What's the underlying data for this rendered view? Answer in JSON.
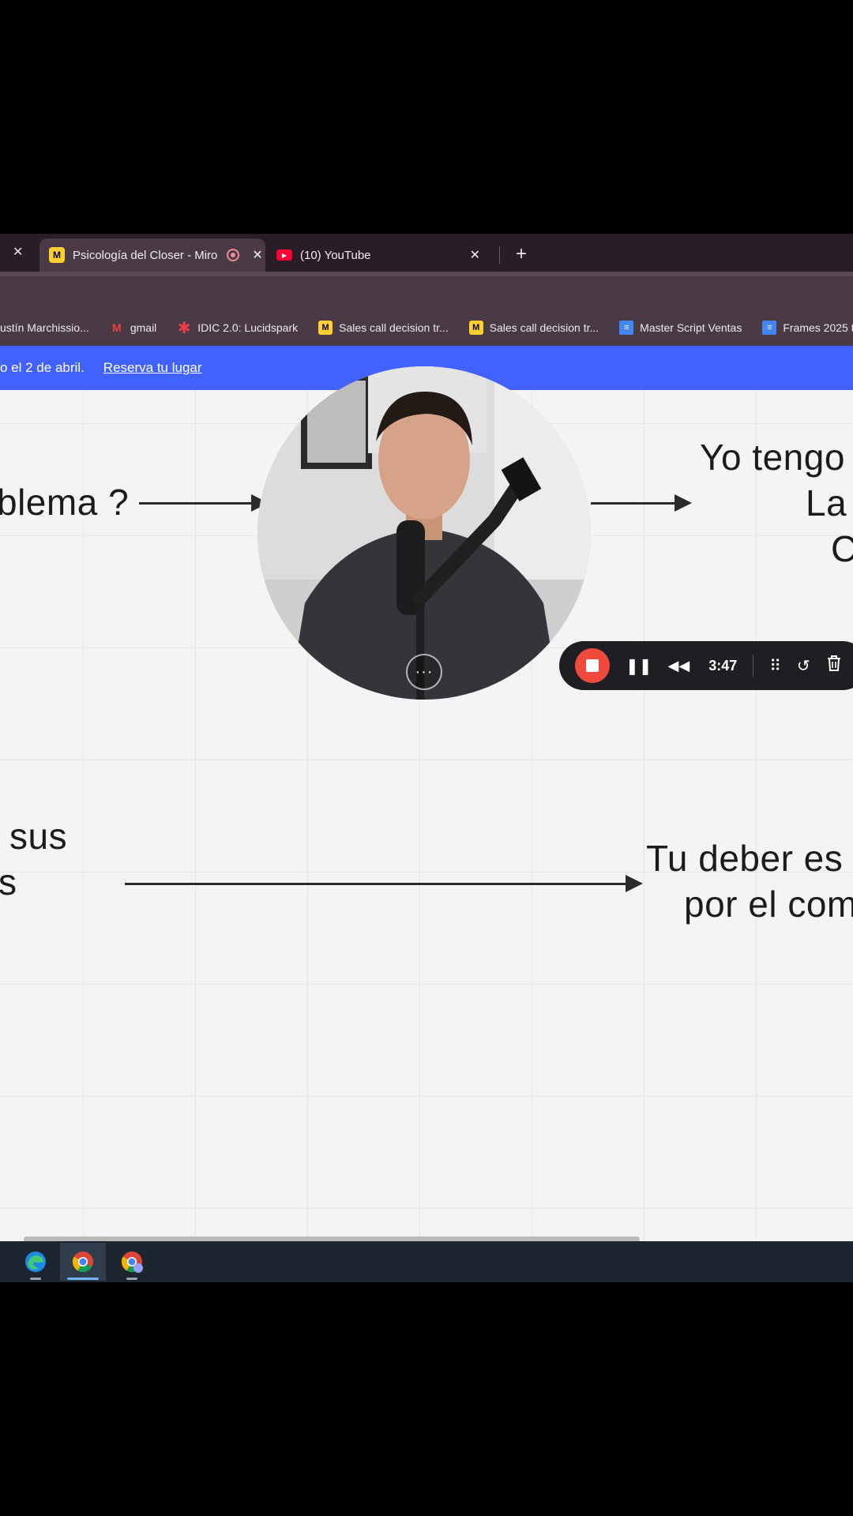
{
  "browser": {
    "tabs": [
      {
        "title": "Psicología del Closer - Miro",
        "active": true,
        "recording": true,
        "favicon": "miro-icon"
      },
      {
        "title": "(10) YouTube",
        "active": false,
        "favicon": "youtube-icon"
      }
    ],
    "close_glyph": "✕",
    "new_tab_glyph": "+",
    "bookmarks": [
      {
        "label": "ustín Marchissio...",
        "icon": "none"
      },
      {
        "label": "gmail",
        "icon": "gmail-icon"
      },
      {
        "label": "IDIC 2.0: Lucidspark",
        "icon": "lucidspark-icon"
      },
      {
        "label": "Sales call decision tr...",
        "icon": "miro-icon"
      },
      {
        "label": "Sales call decision tr...",
        "icon": "miro-icon"
      },
      {
        "label": "Master Script Ventas",
        "icon": "docs-icon"
      },
      {
        "label": "Frames 2025 t",
        "icon": "docs-icon"
      }
    ]
  },
  "banner": {
    "text": "o el 2 de abril.",
    "link": "Reserva tu lugar",
    "color": "#4262ff"
  },
  "board": {
    "text_problem": "blema ?",
    "text_right_1": "Yo tengo",
    "text_right_2": "La",
    "text_right_3": "C",
    "text_sus": "sus",
    "text_s": "s",
    "text_deber_1": "Tu deber es",
    "text_deber_2": "por el com"
  },
  "recorder": {
    "timer": "3:47",
    "more_glyph": "···",
    "accent": "#f04a3e"
  }
}
